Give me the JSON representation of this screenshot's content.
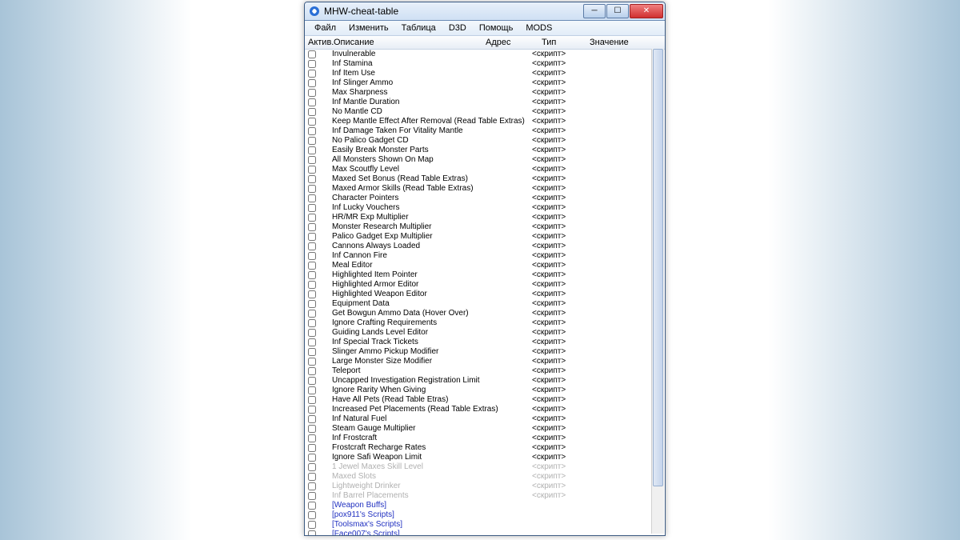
{
  "window": {
    "title": "MHW-cheat-table"
  },
  "menu": [
    "Файл",
    "Изменить",
    "Таблица",
    "D3D",
    "Помощь",
    "MODS"
  ],
  "columns": {
    "active": "Актив.",
    "description": "Описание",
    "address": "Адрес",
    "type": "Тип",
    "value": "Значение"
  },
  "script_label": "<скрипт>",
  "rows": [
    {
      "desc": "Invulnerable",
      "val": "<скрипт>"
    },
    {
      "desc": "Inf Stamina",
      "val": "<скрипт>"
    },
    {
      "desc": "Inf Item Use",
      "val": "<скрипт>"
    },
    {
      "desc": "Inf Slinger Ammo",
      "val": "<скрипт>"
    },
    {
      "desc": "Max Sharpness",
      "val": "<скрипт>"
    },
    {
      "desc": "Inf Mantle Duration",
      "val": "<скрипт>"
    },
    {
      "desc": "No Mantle CD",
      "val": "<скрипт>"
    },
    {
      "desc": "Keep Mantle Effect After Removal (Read Table Extras)",
      "val": "<скрипт>"
    },
    {
      "desc": "Inf Damage Taken For Vitality Mantle",
      "val": "<скрипт>"
    },
    {
      "desc": "No Palico Gadget CD",
      "val": "<скрипт>"
    },
    {
      "desc": "Easily Break Monster Parts",
      "val": "<скрипт>"
    },
    {
      "desc": "All Monsters Shown On Map",
      "val": "<скрипт>"
    },
    {
      "desc": "Max Scoutfly Level",
      "val": "<скрипт>"
    },
    {
      "desc": "Maxed Set Bonus (Read Table Extras)",
      "val": "<скрипт>"
    },
    {
      "desc": "Maxed Armor Skills (Read Table Extras)",
      "val": "<скрипт>"
    },
    {
      "desc": "Character Pointers",
      "val": "<скрипт>"
    },
    {
      "desc": "Inf Lucky Vouchers",
      "val": "<скрипт>"
    },
    {
      "desc": "HR/MR Exp Multiplier",
      "val": "<скрипт>"
    },
    {
      "desc": "Monster Research Multiplier",
      "val": "<скрипт>"
    },
    {
      "desc": "Palico Gadget Exp Multiplier",
      "val": "<скрипт>"
    },
    {
      "desc": "Cannons Always Loaded",
      "val": "<скрипт>"
    },
    {
      "desc": "Inf Cannon Fire",
      "val": "<скрипт>"
    },
    {
      "desc": "Meal Editor",
      "val": "<скрипт>"
    },
    {
      "desc": "Highlighted Item Pointer",
      "val": "<скрипт>"
    },
    {
      "desc": "Highlighted Armor Editor",
      "val": "<скрипт>"
    },
    {
      "desc": "Highlighted Weapon Editor",
      "val": "<скрипт>"
    },
    {
      "desc": "Equipment Data",
      "val": "<скрипт>"
    },
    {
      "desc": "Get Bowgun Ammo Data (Hover Over)",
      "val": "<скрипт>"
    },
    {
      "desc": "Ignore Crafting Requirements",
      "val": "<скрипт>"
    },
    {
      "desc": "Guiding Lands Level Editor",
      "val": "<скрипт>"
    },
    {
      "desc": "Inf Special Track Tickets",
      "val": "<скрипт>"
    },
    {
      "desc": "Slinger Ammo Pickup Modifier",
      "val": "<скрипт>"
    },
    {
      "desc": "Large Monster Size Modifier",
      "val": "<скрипт>"
    },
    {
      "desc": "Teleport",
      "val": "<скрипт>"
    },
    {
      "desc": "Uncapped Investigation Registration Limit",
      "val": "<скрипт>"
    },
    {
      "desc": "Ignore Rarity When Giving",
      "val": "<скрипт>"
    },
    {
      "desc": "Have All Pets (Read Table Etras)",
      "val": "<скрипт>"
    },
    {
      "desc": "Increased Pet Placements (Read Table Extras)",
      "val": "<скрипт>"
    },
    {
      "desc": "Inf Natural Fuel",
      "val": "<скрипт>"
    },
    {
      "desc": "Steam Gauge Multiplier",
      "val": "<скрипт>"
    },
    {
      "desc": "Inf Frostcraft",
      "val": "<скрипт>"
    },
    {
      "desc": "Frostcraft Recharge Rates",
      "val": "<скрипт>"
    },
    {
      "desc": "Ignore Safi Weapon Limit",
      "val": "<скрипт>"
    },
    {
      "desc": "1 Jewel Maxes Skill Level",
      "val": "<скрипт>",
      "disabled": true
    },
    {
      "desc": "Maxed Slots",
      "val": "<скрипт>",
      "disabled": true
    },
    {
      "desc": "Lightweight Drinker",
      "val": "<скрипт>",
      "disabled": true
    },
    {
      "desc": "Inf Barrel Placements",
      "val": "<скрипт>",
      "disabled": true
    },
    {
      "desc": "[Weapon Buffs]",
      "val": "",
      "link": true
    },
    {
      "desc": "[pox911's Scripts]",
      "val": "",
      "link": true
    },
    {
      "desc": "[Toolsmax's Scripts]",
      "val": "",
      "link": true
    },
    {
      "desc": "[Face007's Scripts]",
      "val": "",
      "link": true
    }
  ]
}
